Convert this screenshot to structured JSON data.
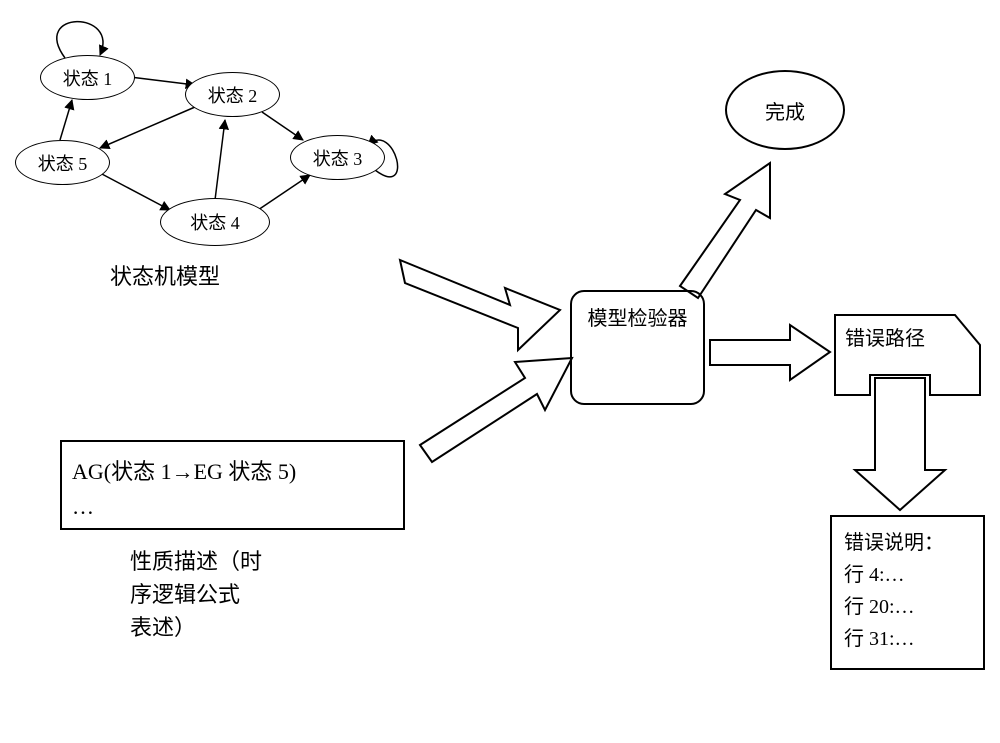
{
  "stateMachine": {
    "nodes": {
      "s1": "状态 1",
      "s2": "状态 2",
      "s3": "状态 3",
      "s4": "状态 4",
      "s5": "状态 5"
    },
    "label": "状态机模型"
  },
  "formula": {
    "line1": "AG(状态 1→EG 状态 5)",
    "line2": "…",
    "caption": "性质描述（时\n序逻辑公式\n表述）"
  },
  "checker": {
    "label": "模型检验器"
  },
  "complete": {
    "label": "完成"
  },
  "errorPath": {
    "label": "错误路径"
  },
  "errorDetail": {
    "title": "错误说明：",
    "line1": "行 4:…",
    "line2": "行 20:…",
    "line3": "行 31:…"
  }
}
